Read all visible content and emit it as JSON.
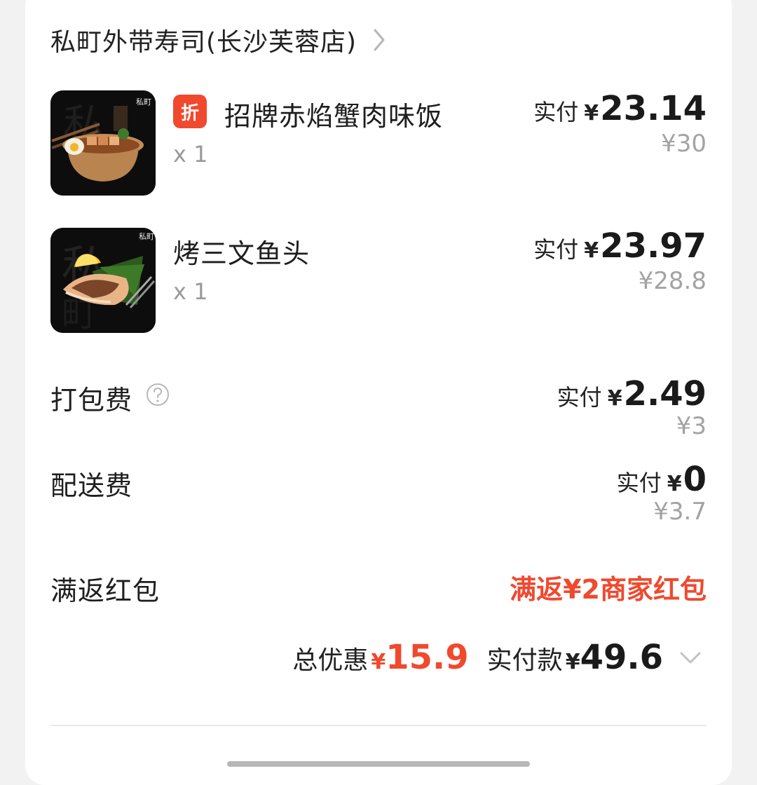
{
  "store": {
    "name": "私町外带寿司(长沙芙蓉店)"
  },
  "items": [
    {
      "badge": "折",
      "name": "招牌赤焰蟹肉味饭",
      "qty": "x 1",
      "pay_label": "实付",
      "currency": "¥",
      "pay_amount": "23.14",
      "original_price": "¥30",
      "image": "crab-rice-bowl-photo"
    },
    {
      "name": "烤三文鱼头",
      "qty": "x 1",
      "pay_label": "实付",
      "currency": "¥",
      "pay_amount": "23.97",
      "original_price": "¥28.8",
      "image": "grilled-salmon-head-photo"
    }
  ],
  "packing_fee": {
    "label": "打包费",
    "pay_label": "实付",
    "currency": "¥",
    "pay_amount": "2.49",
    "original_price": "¥3"
  },
  "delivery_fee": {
    "label": "配送费",
    "pay_label": "实付",
    "currency": "¥",
    "pay_amount": "0",
    "original_price": "¥3.7"
  },
  "red_packet": {
    "label": "满返红包",
    "value": "满返¥2商家红包"
  },
  "summary": {
    "discount_label": "总优惠",
    "currency": "¥",
    "discount_amount": "15.9",
    "paid_label": "实付款",
    "paid_amount": "49.6"
  },
  "colors": {
    "accent_red": "#f0492e",
    "muted": "#a3a3a3"
  }
}
